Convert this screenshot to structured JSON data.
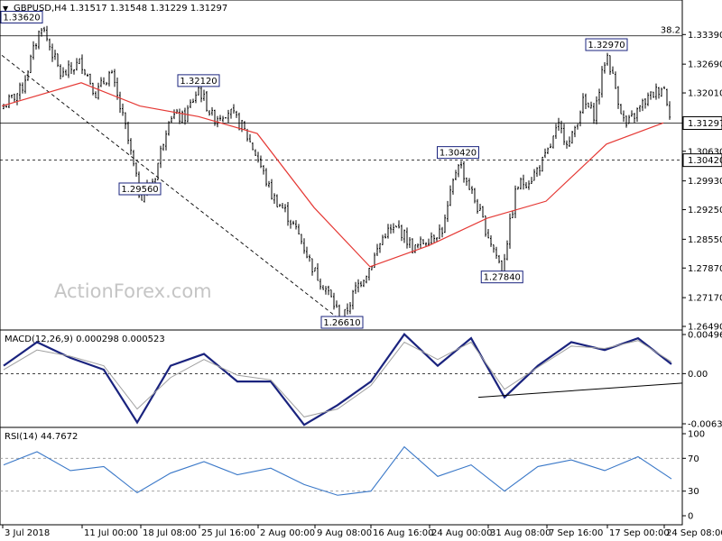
{
  "header": {
    "dropdown_glyph": "▼",
    "symbol_line": "GBPUSD,H4  1.31517 1.31548 1.31229 1.31297"
  },
  "watermark": "ActionForex.com",
  "colors": {
    "bull": "#2e7d32",
    "bear": "#d32f2f",
    "candle": "#000000",
    "moving_average": "#e53935",
    "macd_line": "#1a237e",
    "signal_line": "#a0a0a0",
    "rsi_line": "#3a78c8",
    "label_border": "#1a237e",
    "grid": "#000000"
  },
  "chart_data": [
    {
      "type": "candlestick",
      "title": "GBPUSD,H4",
      "ohlc_readout": [
        "1.31517",
        "1.31548",
        "1.31229",
        "1.31297"
      ],
      "ylim": [
        1.2649,
        1.341
      ],
      "y_ticks": [
        "1.33390",
        "1.32690",
        "1.32010",
        "1.31297",
        "1.30630",
        "1.29930",
        "1.29250",
        "1.28550",
        "1.27870",
        "1.27170",
        "1.26490"
      ],
      "x_ticks": [
        "3 Jul 2018",
        "11 Jul 00:00",
        "18 Jul 08:00",
        "25 Jul 16:00",
        "2 Aug 00:00",
        "9 Aug 08:00",
        "16 Aug 16:00",
        "24 Aug 00:00",
        "31 Aug 08:00",
        "7 Sep 16:00",
        "17 Sep 00:00",
        "24 Sep 08:00"
      ],
      "price_path": [
        [
          "3 Jul 2018",
          1.3165
        ],
        [
          "5 Jul",
          1.321
        ],
        [
          "7 Jul",
          1.3362
        ],
        [
          "9 Jul",
          1.324
        ],
        [
          "11 Jul 00:00",
          1.3275
        ],
        [
          "13 Jul",
          1.32
        ],
        [
          "15 Jul",
          1.325
        ],
        [
          "17 Jul",
          1.312
        ],
        [
          "18 Jul 08:00",
          1.2956
        ],
        [
          "19 Jul",
          1.3
        ],
        [
          "21 Jul",
          1.315
        ],
        [
          "23 Jul",
          1.314
        ],
        [
          "25 Jul 16:00",
          1.3212
        ],
        [
          "27 Jul",
          1.314
        ],
        [
          "29 Jul",
          1.316
        ],
        [
          "31 Jul",
          1.312
        ],
        [
          "2 Aug 00:00",
          1.305
        ],
        [
          "4 Aug",
          1.296
        ],
        [
          "6 Aug",
          1.292
        ],
        [
          "8 Aug",
          1.286
        ],
        [
          "9 Aug 08:00",
          1.278
        ],
        [
          "11 Aug",
          1.273
        ],
        [
          "13 Aug",
          1.2661
        ],
        [
          "15 Aug",
          1.274
        ],
        [
          "16 Aug 16:00",
          1.279
        ],
        [
          "18 Aug",
          1.287
        ],
        [
          "20 Aug",
          1.288
        ],
        [
          "22 Aug",
          1.283
        ],
        [
          "24 Aug 00:00",
          1.286
        ],
        [
          "26 Aug",
          1.288
        ],
        [
          "28 Aug",
          1.3042
        ],
        [
          "30 Aug",
          1.296
        ],
        [
          "31 Aug 08:00",
          1.287
        ],
        [
          "2 Sep",
          1.2784
        ],
        [
          "4 Sep",
          1.298
        ],
        [
          "6 Sep",
          1.3
        ],
        [
          "7 Sep 16:00",
          1.305
        ],
        [
          "9 Sep",
          1.312
        ],
        [
          "11 Sep",
          1.308
        ],
        [
          "13 Sep",
          1.318
        ],
        [
          "15 Sep",
          1.315
        ],
        [
          "17 Sep 00:00",
          1.3297
        ],
        [
          "19 Sep",
          1.312
        ],
        [
          "21 Sep",
          1.318
        ],
        [
          "24 Sep 08:00",
          1.322
        ],
        [
          "25 Sep",
          1.313
        ]
      ],
      "moving_average_path": [
        [
          "3 Jul 2018",
          1.317
        ],
        [
          "11 Jul 00:00",
          1.3225
        ],
        [
          "18 Jul 08:00",
          1.317
        ],
        [
          "25 Jul 16:00",
          1.3145
        ],
        [
          "2 Aug 00:00",
          1.3105
        ],
        [
          "9 Aug 08:00",
          1.293
        ],
        [
          "16 Aug 16:00",
          1.279
        ],
        [
          "24 Aug 00:00",
          1.284
        ],
        [
          "31 Aug 08:00",
          1.2905
        ],
        [
          "7 Sep 16:00",
          1.2945
        ],
        [
          "17 Sep 00:00",
          1.308
        ],
        [
          "24 Sep 08:00",
          1.313
        ]
      ],
      "price_labels": [
        {
          "text": "1.33620",
          "x": "3 Jul 2018",
          "y": 1.3362,
          "anchor": "right"
        },
        {
          "text": "1.32120",
          "x": "25 Jul 16:00",
          "y": 1.3212,
          "anchor": "left"
        },
        {
          "text": "1.29560",
          "x": "18 Jul 08:00",
          "y": 1.2956,
          "anchor": "left"
        },
        {
          "text": "1.26610",
          "x": "13 Aug",
          "y": 1.2661,
          "anchor": "left"
        },
        {
          "text": "1.30420",
          "x": "28 Aug",
          "y": 1.3042,
          "anchor": "left"
        },
        {
          "text": "1.27840",
          "x": "2 Sep",
          "y": 1.2784,
          "anchor": "left"
        },
        {
          "text": "1.32970",
          "x": "17 Sep 00:00",
          "y": 1.3297,
          "anchor": "left"
        }
      ],
      "horizontal_lines": [
        {
          "y": 1.3336,
          "label": "38.2",
          "style": "solid"
        },
        {
          "y": 1.31297,
          "style": "solid"
        },
        {
          "y": 1.3042,
          "style": "dashed"
        }
      ],
      "axis_highlights": [
        "1.31297",
        "1.30420"
      ],
      "trendline": [
        [
          "3 Jul 2018",
          1.329
        ],
        [
          "13 Aug",
          1.2661
        ]
      ]
    },
    {
      "type": "line",
      "title": "MACD(12,26,9) 0.000298 0.000523",
      "ylim": [
        -0.00637,
        0.004968
      ],
      "y_ticks": [
        "0.004968",
        "0.00",
        "-0.006372"
      ],
      "series": [
        {
          "name": "MACD",
          "values": [
            0.001,
            0.004,
            0.002,
            0.0005,
            -0.0062,
            0.001,
            0.0025,
            -0.001,
            -0.001,
            -0.0065,
            -0.004,
            -0.001,
            0.005,
            0.001,
            0.0045,
            -0.003,
            0.001,
            0.004,
            0.003,
            0.0045,
            0.0012
          ]
        },
        {
          "name": "Signal",
          "values": [
            0.0005,
            0.003,
            0.0022,
            0.001,
            -0.0045,
            -0.0005,
            0.0018,
            -0.0002,
            -0.0008,
            -0.0055,
            -0.0045,
            -0.0015,
            0.004,
            0.0018,
            0.004,
            -0.002,
            0.0008,
            0.0035,
            0.0032,
            0.0042,
            0.0015
          ]
        }
      ],
      "trendline": [
        [
          "31 Aug 08:00",
          -0.003
        ],
        [
          "24 Sep 08:00",
          -0.0012
        ]
      ]
    },
    {
      "type": "line",
      "title": "RSI(14) 44.7672",
      "ylim": [
        0,
        100
      ],
      "y_ticks": [
        "100",
        "70",
        "30",
        "0"
      ],
      "series": [
        {
          "name": "RSI",
          "values": [
            62,
            78,
            55,
            60,
            28,
            52,
            66,
            50,
            58,
            38,
            25,
            30,
            84,
            48,
            62,
            30,
            60,
            68,
            55,
            72,
            45
          ]
        }
      ]
    }
  ]
}
